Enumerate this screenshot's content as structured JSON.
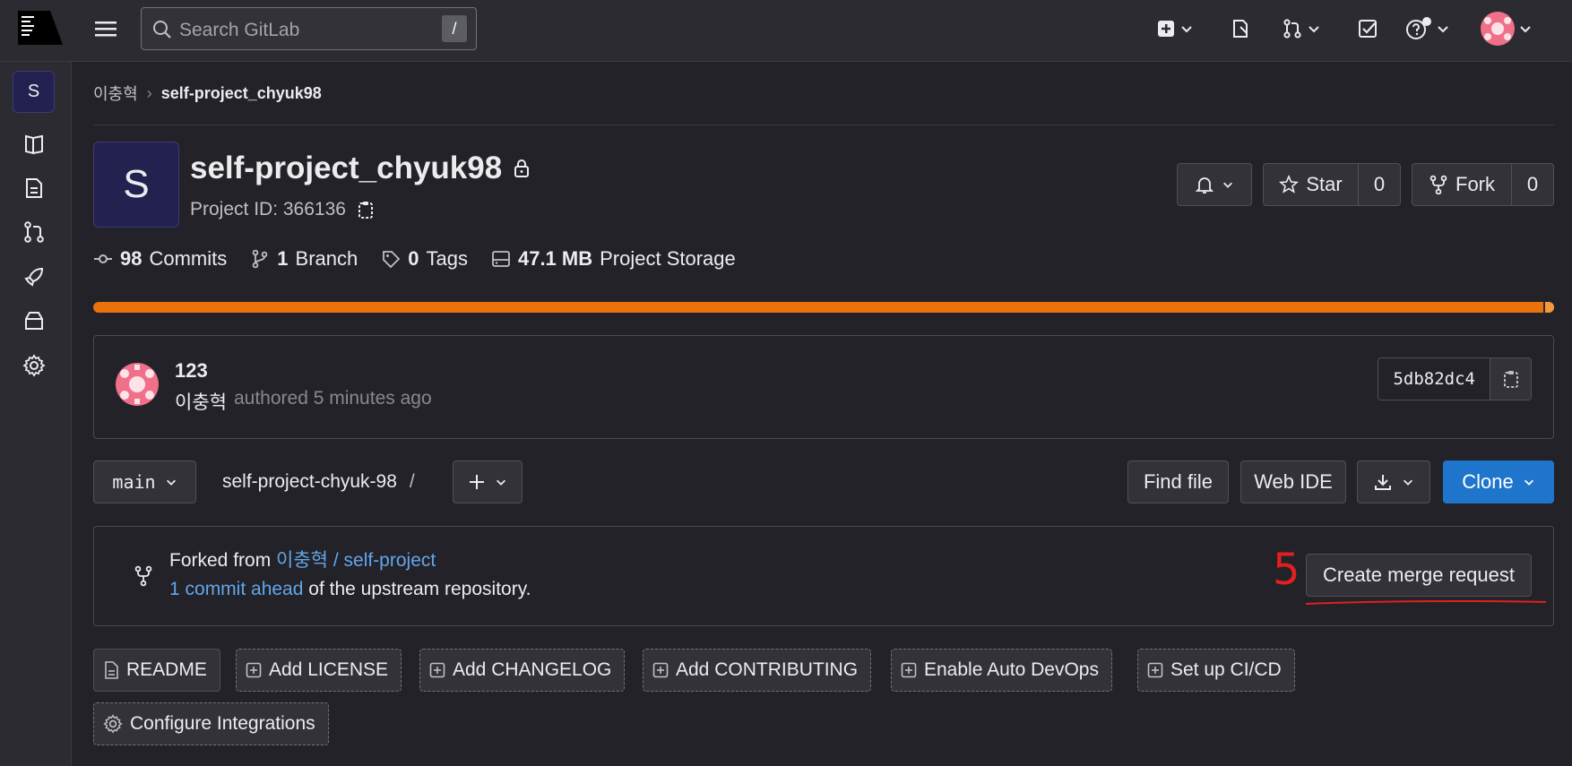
{
  "topbar": {
    "search_placeholder": "Search GitLab",
    "search_shortcut": "/",
    "icons": [
      "logo",
      "hamburger-icon",
      "search-icon",
      "new-item-icon",
      "issues-icon",
      "merge-requests-icon",
      "todo-icon",
      "help-icon",
      "user-avatar"
    ]
  },
  "sidebar": {
    "project_initial": "S",
    "items": [
      "project-overview-icon",
      "issues-icon",
      "merge-requests-icon",
      "deployments-icon",
      "packages-icon",
      "settings-icon"
    ]
  },
  "breadcrumb": {
    "owner": "이충혁",
    "separator": "›",
    "project": "self-project_chyuk98"
  },
  "project": {
    "initial": "S",
    "name": "self-project_chyuk98",
    "id_label": "Project ID: 366136",
    "star_label": "Star",
    "star_count": "0",
    "fork_label": "Fork",
    "fork_count": "0"
  },
  "stats": {
    "commits_count": "98",
    "commits_label": "Commits",
    "branch_count": "1",
    "branch_label": "Branch",
    "tags_count": "0",
    "tags_label": "Tags",
    "storage_size": "47.1 MB",
    "storage_label": "Project Storage"
  },
  "colors": {
    "accent": "#1f75cb",
    "storage_bar": "#e9720d",
    "link": "#63a6e9",
    "annotation": "#e02020"
  },
  "last_commit": {
    "title": "123",
    "author": "이충혁",
    "meta": "authored 5 minutes ago",
    "sha": "5db82dc4"
  },
  "repo_controls": {
    "branch": "main",
    "path": "self-project-chyuk-98",
    "path_sep": "/",
    "find_file": "Find file",
    "web_ide": "Web IDE",
    "clone": "Clone"
  },
  "fork_info": {
    "forked_from_label": "Forked from",
    "forked_from_link": "이충혁 / self-project",
    "ahead_link": "1 commit ahead",
    "ahead_suffix": "of the upstream repository.",
    "create_mr": "Create merge request",
    "annotation_mark": "5"
  },
  "quick_actions": [
    "README",
    "Add LICENSE",
    "Add CHANGELOG",
    "Add CONTRIBUTING",
    "Enable Auto DevOps",
    "Set up CI/CD",
    "Configure Integrations"
  ]
}
